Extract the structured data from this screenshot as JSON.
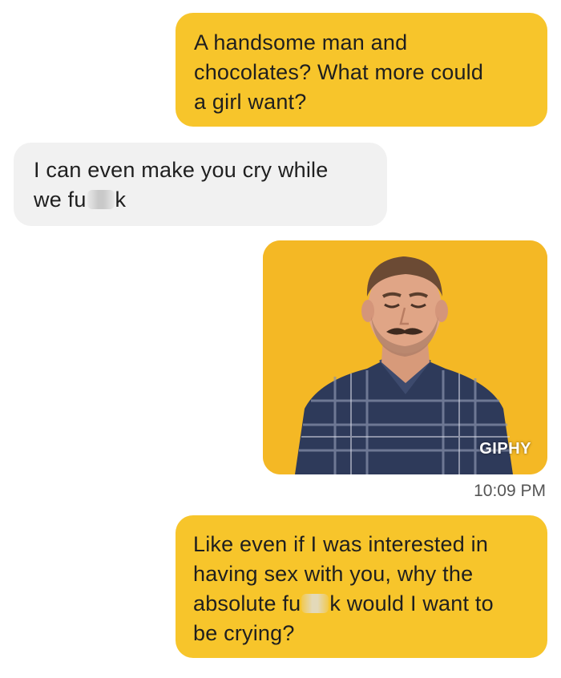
{
  "conversation": {
    "messages": [
      {
        "direction": "sent",
        "lines": [
          "A handsome man and",
          "chocolates? What more could",
          "a girl want?"
        ]
      },
      {
        "direction": "received",
        "lines": [
          "I can even make you cry while",
          "we fu"
        ],
        "line2_suffix": "k"
      },
      {
        "direction": "sent",
        "type": "gif",
        "gif_label": "GIPHY",
        "timestamp": "10:09 PM"
      },
      {
        "direction": "sent",
        "lines": [
          "Like even if I was interested in",
          "having sex with you, why the",
          "absolute fu",
          "be crying?"
        ],
        "line3_suffix": "k would I want to"
      }
    ]
  },
  "colors": {
    "sent_bubble": "#f7c52b",
    "received_bubble": "#f1f1f1",
    "gif_background": "#f4b825"
  },
  "icons": {
    "gif": "man-with-closed-eyes-gif"
  }
}
